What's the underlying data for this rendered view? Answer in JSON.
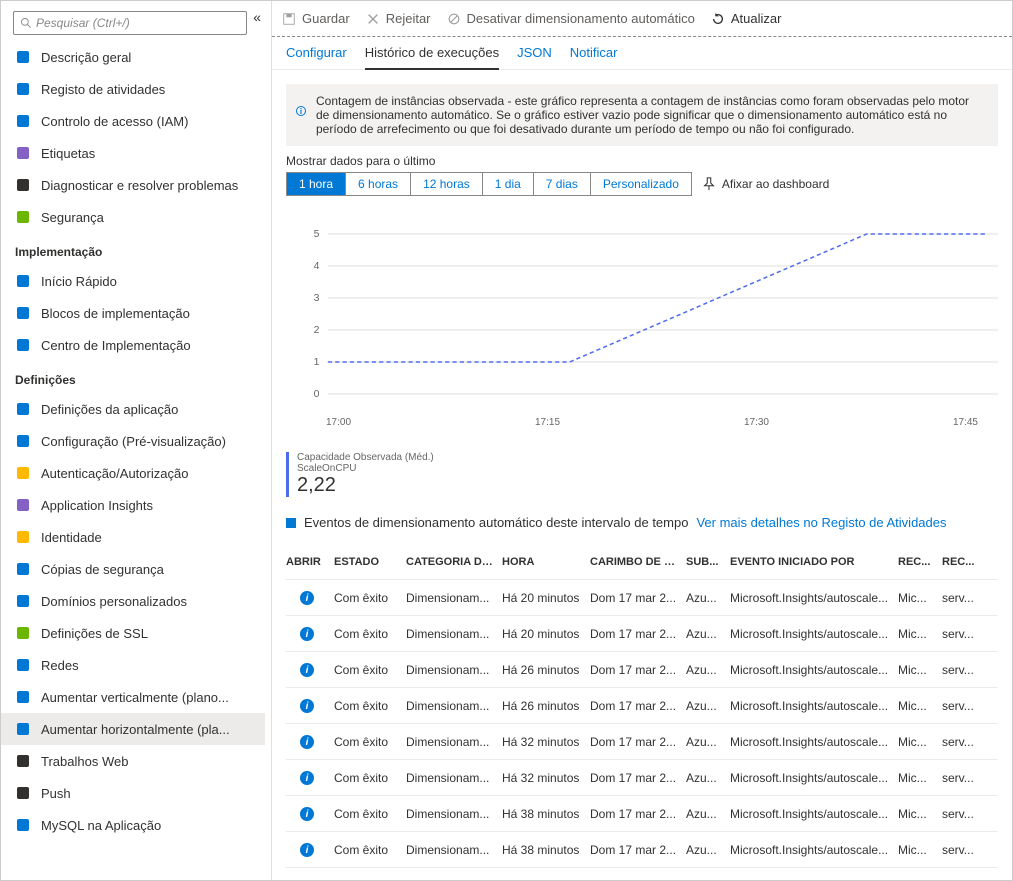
{
  "search": {
    "placeholder": "Pesquisar (Ctrl+/)"
  },
  "sidebar": {
    "top_items": [
      {
        "label": "Descrição geral",
        "icon": "globe"
      },
      {
        "label": "Registo de atividades",
        "icon": "log"
      },
      {
        "label": "Controlo de acesso (IAM)",
        "icon": "people"
      },
      {
        "label": "Etiquetas",
        "icon": "tag"
      },
      {
        "label": "Diagnosticar e resolver problemas",
        "icon": "tools"
      },
      {
        "label": "Segurança",
        "icon": "shield"
      }
    ],
    "group_impl": "Implementação",
    "impl_items": [
      {
        "label": "Início Rápido",
        "icon": "rocket"
      },
      {
        "label": "Blocos de implementação",
        "icon": "blocks"
      },
      {
        "label": "Centro de Implementação",
        "icon": "deploy"
      }
    ],
    "group_def": "Definições",
    "def_items": [
      {
        "label": "Definições da aplicação",
        "icon": "sliders"
      },
      {
        "label": "Configuração (Pré-visualização)",
        "icon": "config"
      },
      {
        "label": "Autenticação/Autorização",
        "icon": "key"
      },
      {
        "label": "Application Insights",
        "icon": "bulb"
      },
      {
        "label": "Identidade",
        "icon": "id"
      },
      {
        "label": "Cópias de segurança",
        "icon": "backup"
      },
      {
        "label": "Domínios personalizados",
        "icon": "domain"
      },
      {
        "label": "Definições de SSL",
        "icon": "ssl"
      },
      {
        "label": "Redes",
        "icon": "net"
      },
      {
        "label": "Aumentar verticalmente (plano...",
        "icon": "scaleup"
      },
      {
        "label": "Aumentar horizontalmente (pla...",
        "icon": "scaleout",
        "active": true
      },
      {
        "label": "Trabalhos Web",
        "icon": "webjobs"
      },
      {
        "label": "Push",
        "icon": "push"
      },
      {
        "label": "MySQL na Aplicação",
        "icon": "mysql"
      }
    ]
  },
  "toolbar": {
    "save": "Guardar",
    "reject": "Rejeitar",
    "disable": "Desativar dimensionamento automático",
    "refresh": "Atualizar"
  },
  "tabs": {
    "configure": "Configurar",
    "history": "Histórico de execuções",
    "json": "JSON",
    "notify": "Notificar"
  },
  "info": "Contagem de instâncias observada - este gráfico representa a contagem de instâncias como foram observadas pelo motor de dimensionamento automático. Se o gráfico estiver vazio pode significar que o dimensionamento automático está no período de arrefecimento ou que foi desativado durante um período de tempo ou não foi configurado.",
  "range_label": "Mostrar dados para o último",
  "ranges": [
    "1 hora",
    "6 horas",
    "12 horas",
    "1 dia",
    "7 dias",
    "Personalizado"
  ],
  "pin": "Afixar ao dashboard",
  "metric": {
    "label": "Capacidade Observada (Méd.)",
    "sub": "ScaleOnCPU",
    "value": "2,22"
  },
  "section": {
    "title": "Eventos de dimensionamento automático deste intervalo de tempo",
    "link": "Ver mais detalhes no Registo de Atividades"
  },
  "table": {
    "headers": [
      "ABRIR",
      "ESTADO",
      "CATEGORIA DE...",
      "HORA",
      "CARIMBO DE D...",
      "SUB...",
      "EVENTO INICIADO POR",
      "REC...",
      "REC..."
    ],
    "rows": [
      {
        "estado": "Com êxito",
        "cat": "Dimensionam...",
        "hora": "Há 20 minutos",
        "ts": "Dom 17 mar 2...",
        "sub": "Azu...",
        "ev": "Microsoft.Insights/autoscale...",
        "r1": "Mic...",
        "r2": "serv..."
      },
      {
        "estado": "Com êxito",
        "cat": "Dimensionam...",
        "hora": "Há 20 minutos",
        "ts": "Dom 17 mar 2...",
        "sub": "Azu...",
        "ev": "Microsoft.Insights/autoscale...",
        "r1": "Mic...",
        "r2": "serv..."
      },
      {
        "estado": "Com êxito",
        "cat": "Dimensionam...",
        "hora": "Há 26 minutos",
        "ts": "Dom 17 mar 2...",
        "sub": "Azu...",
        "ev": "Microsoft.Insights/autoscale...",
        "r1": "Mic...",
        "r2": "serv..."
      },
      {
        "estado": "Com êxito",
        "cat": "Dimensionam...",
        "hora": "Há 26 minutos",
        "ts": "Dom 17 mar 2...",
        "sub": "Azu...",
        "ev": "Microsoft.Insights/autoscale...",
        "r1": "Mic...",
        "r2": "serv..."
      },
      {
        "estado": "Com êxito",
        "cat": "Dimensionam...",
        "hora": "Há 32 minutos",
        "ts": "Dom 17 mar 2...",
        "sub": "Azu...",
        "ev": "Microsoft.Insights/autoscale...",
        "r1": "Mic...",
        "r2": "serv..."
      },
      {
        "estado": "Com êxito",
        "cat": "Dimensionam...",
        "hora": "Há 32 minutos",
        "ts": "Dom 17 mar 2...",
        "sub": "Azu...",
        "ev": "Microsoft.Insights/autoscale...",
        "r1": "Mic...",
        "r2": "serv..."
      },
      {
        "estado": "Com êxito",
        "cat": "Dimensionam...",
        "hora": "Há 38 minutos",
        "ts": "Dom 17 mar 2...",
        "sub": "Azu...",
        "ev": "Microsoft.Insights/autoscale...",
        "r1": "Mic...",
        "r2": "serv..."
      },
      {
        "estado": "Com êxito",
        "cat": "Dimensionam...",
        "hora": "Há 38 minutos",
        "ts": "Dom 17 mar 2...",
        "sub": "Azu...",
        "ev": "Microsoft.Insights/autoscale...",
        "r1": "Mic...",
        "r2": "serv..."
      }
    ]
  },
  "chart_data": {
    "type": "line",
    "title": "Capacidade Observada",
    "xlabel": "",
    "ylabel": "",
    "ylim": [
      0,
      5
    ],
    "y_ticks": [
      0,
      1,
      2,
      3,
      4,
      5
    ],
    "x_ticks": [
      "17:00",
      "17:15",
      "17:30",
      "17:45"
    ],
    "series": [
      {
        "name": "ScaleOnCPU",
        "points": [
          [
            "16:55",
            1
          ],
          [
            "17:17",
            1
          ],
          [
            "17:44",
            5
          ],
          [
            "17:55",
            5
          ]
        ]
      }
    ]
  }
}
